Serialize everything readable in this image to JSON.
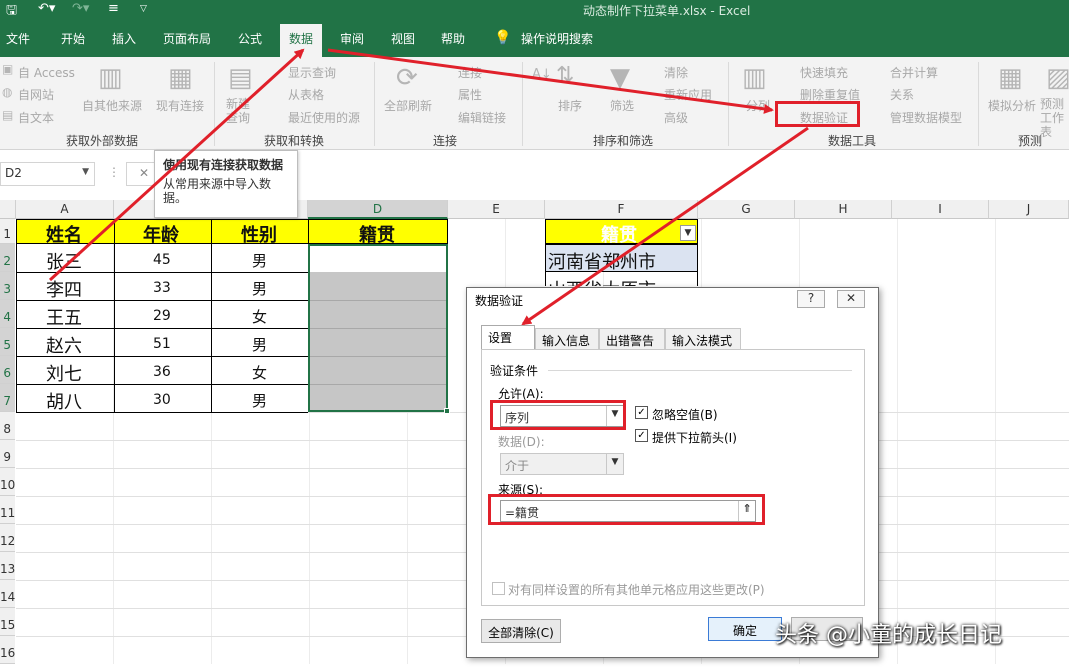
{
  "window": {
    "title": "动态制作下拉菜单.xlsx  -  Excel"
  },
  "tabs": [
    "文件",
    "开始",
    "插入",
    "页面布局",
    "公式",
    "数据",
    "审阅",
    "视图",
    "帮助"
  ],
  "active_tab": "数据",
  "tell_me": "操作说明搜索",
  "ribbon": {
    "get_external": {
      "items": [
        "自 Access",
        "自网站",
        "自文本",
        "自其他来源",
        "现有连接"
      ],
      "label": "获取外部数据"
    },
    "get_transform": {
      "new_query": "新建查询",
      "items": [
        "显示查询",
        "从表格",
        "最近使用的源"
      ],
      "label": "获取和转换"
    },
    "connections": {
      "refresh_all": "全部刷新",
      "items": [
        "连接",
        "属性",
        "编辑链接"
      ],
      "label": "连接"
    },
    "sort_filter": {
      "sort": "排序",
      "filter": "筛选",
      "items": [
        "清除",
        "重新应用",
        "高级"
      ],
      "label": "排序和筛选"
    },
    "data_tools": {
      "split": "分列",
      "items": [
        "快速填充",
        "删除重复值",
        "数据验证"
      ],
      "items2": [
        "合并计算",
        "关系",
        "管理数据模型"
      ],
      "label": "数据工具"
    },
    "forecast": {
      "what_if": "模拟分析",
      "forecast_sheet": "预测工作表",
      "label": "预测"
    }
  },
  "tooltip": {
    "title": "使用现有连接获取数据",
    "body": "从常用来源中导入数据。"
  },
  "name_box": "D2",
  "columns": [
    "A",
    "B",
    "C",
    "D",
    "E",
    "F",
    "G",
    "H",
    "I",
    "J"
  ],
  "rows": [
    "1",
    "2",
    "3",
    "4",
    "5",
    "6",
    "7",
    "8",
    "9",
    "10",
    "11",
    "12",
    "13",
    "14",
    "15",
    "16"
  ],
  "table": {
    "headers": [
      "姓名",
      "年龄",
      "性别",
      "籍贯"
    ],
    "data": [
      [
        "张三",
        "45",
        "男"
      ],
      [
        "李四",
        "33",
        "男"
      ],
      [
        "王五",
        "29",
        "女"
      ],
      [
        "赵六",
        "51",
        "男"
      ],
      [
        "刘七",
        "36",
        "女"
      ],
      [
        "胡八",
        "30",
        "男"
      ]
    ]
  },
  "origin": {
    "header": "籍贯",
    "items": [
      "河南省郑州市",
      "山西省太原市"
    ]
  },
  "dialog": {
    "title": "数据验证",
    "help": "?",
    "close": "✕",
    "tabs": [
      "设置",
      "输入信息",
      "出错警告",
      "输入法模式"
    ],
    "section": "验证条件",
    "allow_label": "允许(A):",
    "allow_value": "序列",
    "ignore_blank": "忽略空值(B)",
    "in_cell_dropdown": "提供下拉箭头(I)",
    "data_label": "数据(D):",
    "data_value": "介于",
    "source_label": "来源(S):",
    "source_value": "=籍贯",
    "apply_all": "对有同样设置的所有其他单元格应用这些更改(P)",
    "clear_all": "全部清除(C)",
    "ok": "确定"
  },
  "watermark": "头条 @小童的成长日记",
  "colors": {
    "excel_green": "#217346",
    "header_yellow": "#ffff00",
    "arrow_red": "#e0202a"
  }
}
